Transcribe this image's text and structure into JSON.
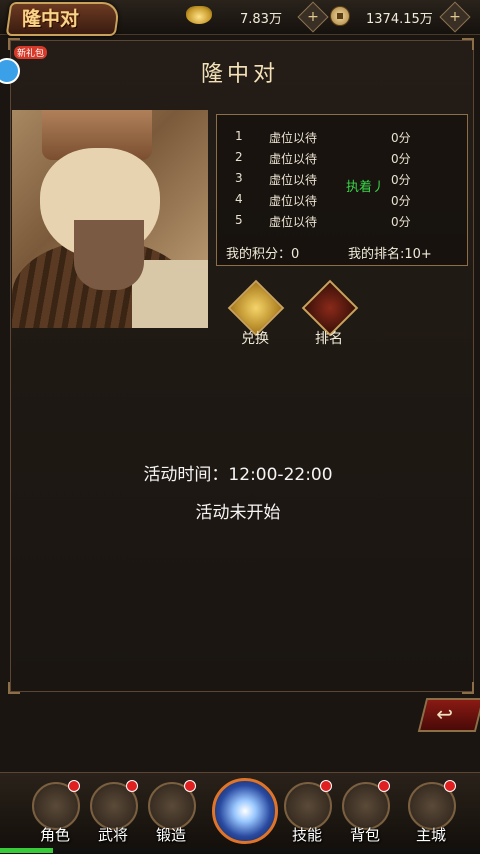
{
  "header": {
    "tab_title": "隆中对",
    "gold_value": "7.83万",
    "coin_value": "1374.15万",
    "add_symbol": "+"
  },
  "gift": {
    "label": "新礼包"
  },
  "page_title": "隆中对",
  "ranking": {
    "rows": [
      {
        "rank": "1",
        "name": "虚位以待",
        "score": "0分"
      },
      {
        "rank": "2",
        "name": "虚位以待",
        "score": "0分"
      },
      {
        "rank": "3",
        "name": "虚位以待",
        "score": "0分"
      },
      {
        "rank": "4",
        "name": "虚位以待",
        "score": "0分"
      },
      {
        "rank": "5",
        "name": "虚位以待",
        "score": "0分"
      }
    ],
    "overlay_text": "执着丿",
    "my_score": "我的积分：0",
    "my_rank": "我的排名:10+"
  },
  "actions": {
    "exchange": "兑换",
    "ranking": "排名"
  },
  "activity": {
    "time": "活动时间：12:00-22:00",
    "status": "活动未开始"
  },
  "back_symbol": "↩",
  "nav": [
    {
      "label": "角色"
    },
    {
      "label": "武将"
    },
    {
      "label": "锻造"
    },
    {
      "label": "技能"
    },
    {
      "label": "背包"
    },
    {
      "label": "主城"
    }
  ],
  "progress": {
    "fraction": 0.11
  },
  "colors": {
    "accent_gold": "#c9a25c",
    "status_green": "#3ad44a",
    "badge_red": "#e02020"
  }
}
